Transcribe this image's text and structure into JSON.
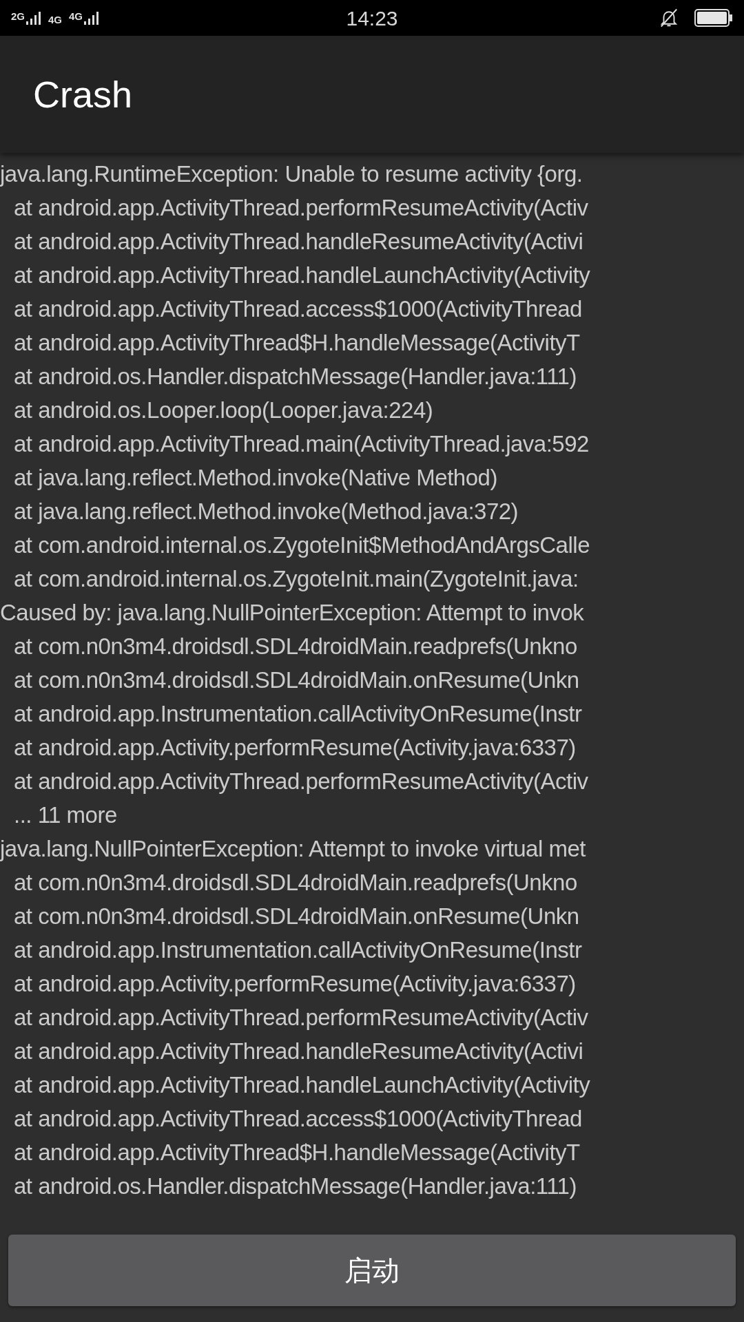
{
  "status_bar": {
    "networks": [
      "2G",
      "4G",
      "4G"
    ],
    "time": "14:23"
  },
  "app_bar": {
    "title": "Crash"
  },
  "log": [
    {
      "kind": "header",
      "text": "java.lang.RuntimeException: Unable to resume activity {org."
    },
    {
      "kind": "frame",
      "text": "at android.app.ActivityThread.performResumeActivity(Activ"
    },
    {
      "kind": "frame",
      "text": "at android.app.ActivityThread.handleResumeActivity(Activi"
    },
    {
      "kind": "frame",
      "text": "at android.app.ActivityThread.handleLaunchActivity(Activity"
    },
    {
      "kind": "frame",
      "text": "at android.app.ActivityThread.access$1000(ActivityThread"
    },
    {
      "kind": "frame",
      "text": "at android.app.ActivityThread$H.handleMessage(ActivityT"
    },
    {
      "kind": "frame",
      "text": "at android.os.Handler.dispatchMessage(Handler.java:111)"
    },
    {
      "kind": "frame",
      "text": "at android.os.Looper.loop(Looper.java:224)"
    },
    {
      "kind": "frame",
      "text": "at android.app.ActivityThread.main(ActivityThread.java:592"
    },
    {
      "kind": "frame",
      "text": "at java.lang.reflect.Method.invoke(Native Method)"
    },
    {
      "kind": "frame",
      "text": "at java.lang.reflect.Method.invoke(Method.java:372)"
    },
    {
      "kind": "frame",
      "text": "at com.android.internal.os.ZygoteInit$MethodAndArgsCalle"
    },
    {
      "kind": "frame",
      "text": "at com.android.internal.os.ZygoteInit.main(ZygoteInit.java:"
    },
    {
      "kind": "header",
      "text": "Caused by: java.lang.NullPointerException: Attempt to invok"
    },
    {
      "kind": "frame",
      "text": "at com.n0n3m4.droidsdl.SDL4droidMain.readprefs(Unkno"
    },
    {
      "kind": "frame",
      "text": "at com.n0n3m4.droidsdl.SDL4droidMain.onResume(Unkn"
    },
    {
      "kind": "frame",
      "text": "at android.app.Instrumentation.callActivityOnResume(Instr"
    },
    {
      "kind": "frame",
      "text": "at android.app.Activity.performResume(Activity.java:6337)"
    },
    {
      "kind": "frame",
      "text": "at android.app.ActivityThread.performResumeActivity(Activ"
    },
    {
      "kind": "frame",
      "text": "... 11 more"
    },
    {
      "kind": "header",
      "text": "java.lang.NullPointerException: Attempt to invoke virtual met"
    },
    {
      "kind": "frame",
      "text": "at com.n0n3m4.droidsdl.SDL4droidMain.readprefs(Unkno"
    },
    {
      "kind": "frame",
      "text": "at com.n0n3m4.droidsdl.SDL4droidMain.onResume(Unkn"
    },
    {
      "kind": "frame",
      "text": "at android.app.Instrumentation.callActivityOnResume(Instr"
    },
    {
      "kind": "frame",
      "text": "at android.app.Activity.performResume(Activity.java:6337)"
    },
    {
      "kind": "frame",
      "text": "at android.app.ActivityThread.performResumeActivity(Activ"
    },
    {
      "kind": "frame",
      "text": "at android.app.ActivityThread.handleResumeActivity(Activi"
    },
    {
      "kind": "frame",
      "text": "at android.app.ActivityThread.handleLaunchActivity(Activity"
    },
    {
      "kind": "frame",
      "text": "at android.app.ActivityThread.access$1000(ActivityThread"
    },
    {
      "kind": "frame",
      "text": "at android.app.ActivityThread$H.handleMessage(ActivityT"
    },
    {
      "kind": "frame",
      "text": "at android.os.Handler.dispatchMessage(Handler.java:111)"
    }
  ],
  "button": {
    "label": "启动"
  }
}
